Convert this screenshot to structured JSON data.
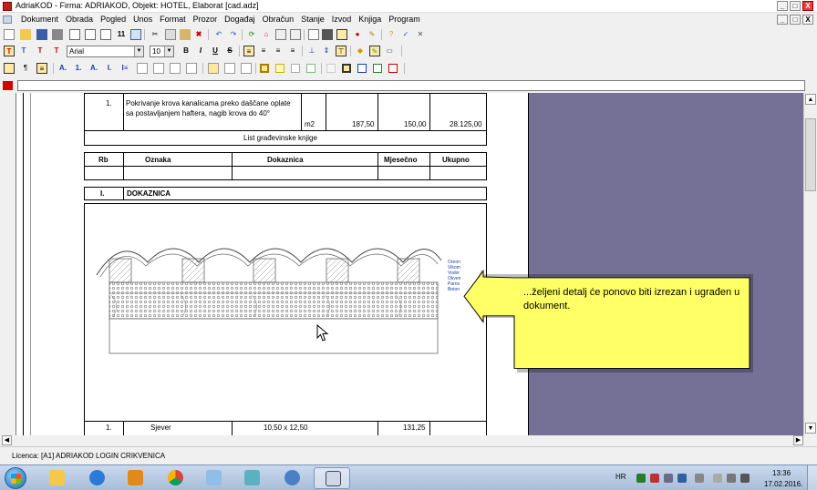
{
  "window": {
    "title": "AdriaKOD - Firma: ADRIAKOD,   Objekt: HOTEL, Elaborat [cad.adz]",
    "minimize": "_",
    "maximize": "□",
    "close": "X",
    "doc_minimize": "_",
    "doc_maximize": "□",
    "doc_close": "X"
  },
  "menu": [
    "Dokument",
    "Obrada",
    "Pogled",
    "Unos",
    "Format",
    "Prozor",
    "Događaj",
    "Obračun",
    "Stanje",
    "Izvod",
    "Knjiga",
    "Program"
  ],
  "format_toolbar": {
    "text_buttons": [
      "T",
      "T",
      "T",
      "T"
    ],
    "font": "Arial",
    "size": "10",
    "bold": "B",
    "italic": "I",
    "underline": "U",
    "strike": "S"
  },
  "toolbar3": {
    "label_buttons": [
      "A.",
      "1.",
      "A.",
      "I.",
      "I≡"
    ]
  },
  "document": {
    "item": {
      "rb": "1.",
      "description": "Pokrivanje krova kanalicama preko daščane oplate sa postavljanjem haftera, nagib krova do 40°",
      "unit": "m2",
      "qty": "187,50",
      "price": "150,00",
      "total": "28.125,00"
    },
    "list_title": "List građevinske knjige",
    "headers": [
      "Rb",
      "Oznaka",
      "Dokaznica",
      "Mjesečno",
      "Ukupno"
    ],
    "section": {
      "num": "I.",
      "title": "DOKAZNICA"
    },
    "drawing_labels": [
      "Oreon",
      "Vikom",
      "Vodor",
      "Okven",
      "Parno",
      "Beton"
    ],
    "bottom_row": {
      "rb": "1.",
      "oznaka": "Sjever",
      "dokaznica": "10,50 x 12,50",
      "mjesecno": "131,25"
    }
  },
  "callout": {
    "text": "...željeni detalj će ponovo biti izrezan i ugrađen u dokument.",
    "fill": "#ffff66",
    "border": "#000000"
  },
  "status": {
    "licence": "Licenca:  [A1] ADRIAKOD LOGIN CRIKVENICA"
  },
  "taskbar": {
    "lang": "HR",
    "time": "13:36",
    "date": "17.02.2016."
  },
  "colors": {
    "workspace": "#757095",
    "red_indicator": "#d40000"
  }
}
